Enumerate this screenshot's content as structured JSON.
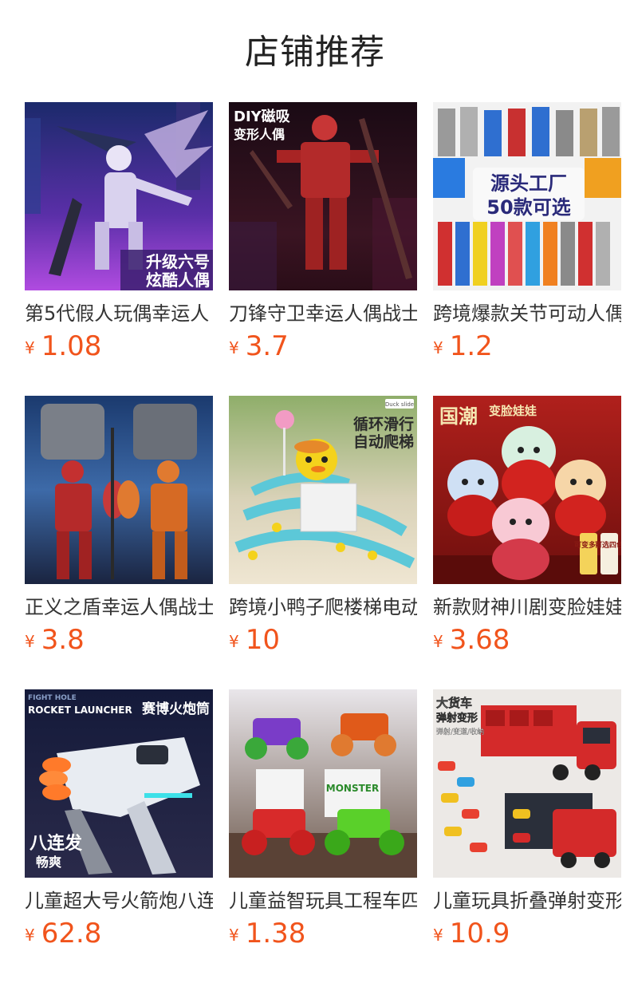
{
  "page": {
    "title": "店铺推荐"
  },
  "colors": {
    "price": "#f1541c",
    "text": "#333333",
    "background": "#ffffff"
  },
  "products": [
    {
      "name": "第5代假人玩偶幸运人",
      "currency": "¥",
      "price": "1.08",
      "image": "robot-figure-crystal",
      "image_text": [
        "升级六号",
        "炫酷人偶"
      ]
    },
    {
      "name": "刀锋守卫幸运人偶战士",
      "currency": "¥",
      "price": "3.7",
      "image": "robot-figure-red",
      "image_text": [
        "DIY磁吸",
        "变形人偶"
      ]
    },
    {
      "name": "跨境爆款关节可动人偶",
      "currency": "¥",
      "price": "1.2",
      "image": "robot-figures-collection",
      "image_text": [
        "源头工厂",
        "50款可选"
      ]
    },
    {
      "name": "正义之盾幸运人偶战士",
      "currency": "¥",
      "price": "3.8",
      "image": "robot-figures-axe",
      "image_text": []
    },
    {
      "name": "跨境小鸭子爬楼梯电动",
      "currency": "¥",
      "price": "10",
      "image": "duck-slide-toy",
      "image_text": [
        "Duck slide",
        "循环滑行",
        "自动爬梯"
      ]
    },
    {
      "name": "新款财神川剧变脸娃娃",
      "currency": "¥",
      "price": "3.68",
      "image": "face-changing-dolls",
      "image_text": [
        "国潮",
        "变脸娃娃",
        "可变多脸",
        "可选四色"
      ]
    },
    {
      "name": "儿童超大号火箭炮八连发",
      "currency": "¥",
      "price": "62.8",
      "image": "rocket-launcher-toy",
      "image_text": [
        "FIGHT HOLE",
        "ROCKET LAUNCHER",
        "赛博火炮筒",
        "八连发",
        "畅爽"
      ]
    },
    {
      "name": "儿童益智玩具工程车四驱",
      "currency": "¥",
      "price": "1.38",
      "image": "monster-trucks",
      "image_text": [
        "MONSTER"
      ]
    },
    {
      "name": "儿童玩具折叠弹射变形",
      "currency": "¥",
      "price": "10.9",
      "image": "truck-carrier-toy",
      "image_text": [
        "大货车",
        "弹射变形",
        "弹射/变道/收纳"
      ]
    }
  ]
}
